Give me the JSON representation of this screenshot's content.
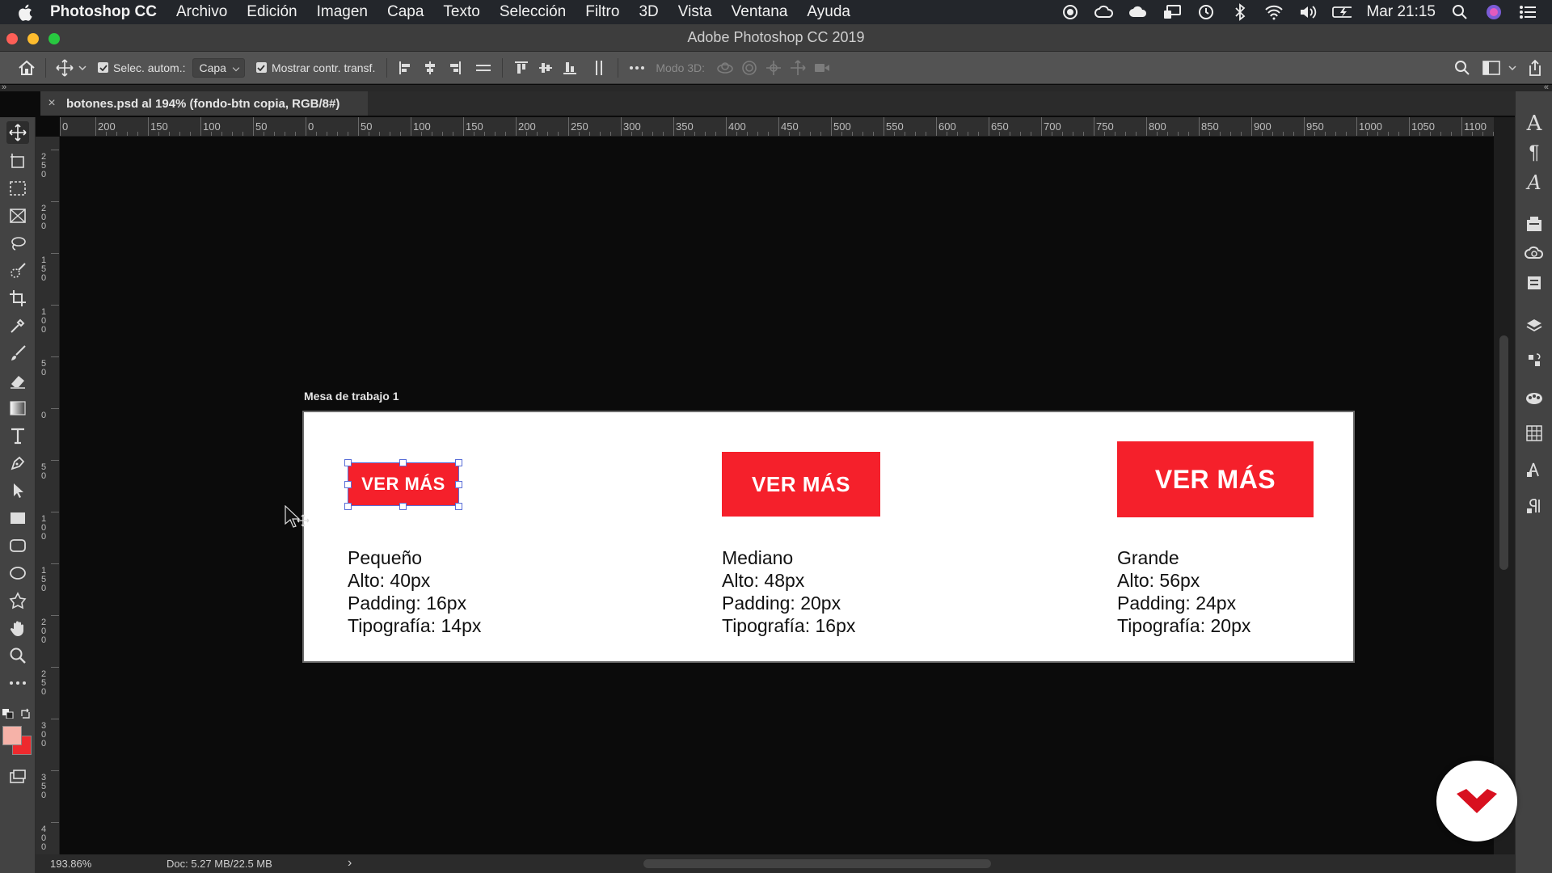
{
  "menubar": {
    "app_name": "Photoshop CC",
    "items": [
      "Archivo",
      "Edición",
      "Imagen",
      "Capa",
      "Texto",
      "Selección",
      "Filtro",
      "3D",
      "Vista",
      "Ventana",
      "Ayuda"
    ],
    "clock": "Mar 21:15"
  },
  "window": {
    "title": "Adobe Photoshop CC 2019"
  },
  "options": {
    "auto_select_label": "Selec. autom.:",
    "auto_select_value": "Capa",
    "show_transform_label": "Mostrar contr. transf.",
    "mode_3d_label": "Modo 3D:"
  },
  "tab": {
    "title": "botones.psd al 194% (fondo-btn copia, RGB/8#)"
  },
  "ruler": {
    "top_labels": [
      "0",
      "200",
      "150",
      "100",
      "50",
      "0",
      "50",
      "100",
      "150",
      "200",
      "250",
      "300",
      "350",
      "400",
      "450",
      "500",
      "550",
      "600",
      "650",
      "700",
      "750",
      "800",
      "850",
      "900",
      "950",
      "1000",
      "1050",
      "1100"
    ],
    "left_labels": [
      "250",
      "200",
      "150",
      "100",
      "50",
      "0",
      "50",
      "100",
      "150",
      "200",
      "250",
      "300",
      "350",
      "400"
    ]
  },
  "artboard": {
    "label": "Mesa de trabajo 1",
    "buttons": [
      {
        "text": "VER MÁS",
        "info": [
          "Pequeño",
          "Alto: 40px",
          "Padding: 16px",
          "Tipografía: 14px"
        ]
      },
      {
        "text": "VER MÁS",
        "info": [
          "Mediano",
          "Alto: 48px",
          "Padding: 20px",
          "Tipografía: 16px"
        ]
      },
      {
        "text": "VER MÁS",
        "info": [
          "Grande",
          "Alto: 56px",
          "Padding: 24px",
          "Tipografía: 20px"
        ]
      }
    ],
    "button_color": "#f5202b"
  },
  "status": {
    "zoom": "193.86%",
    "doc": "Doc: 5.27 MB/22.5 MB",
    "arrow": "›"
  },
  "colors": {
    "foreground": "#f6b2a8",
    "background": "#ee2a2e"
  },
  "tools": [
    "move-tool",
    "artboard-tool",
    "marquee-tool",
    "frame-tool",
    "lasso-tool",
    "quick-selection-tool",
    "crop-tool",
    "eyedropper-tool",
    "brush-tool",
    "eraser-tool",
    "gradient-tool",
    "type-tool",
    "pen-tool",
    "path-selection-tool",
    "rectangle-tool",
    "rounded-rectangle-tool",
    "ellipse-tool",
    "custom-shape-tool",
    "hand-tool",
    "zoom-tool",
    "more-tools"
  ],
  "dock_text": {
    "type_glyph": "A",
    "paragraph_glyph": "¶",
    "char_style_glyph": "A"
  }
}
